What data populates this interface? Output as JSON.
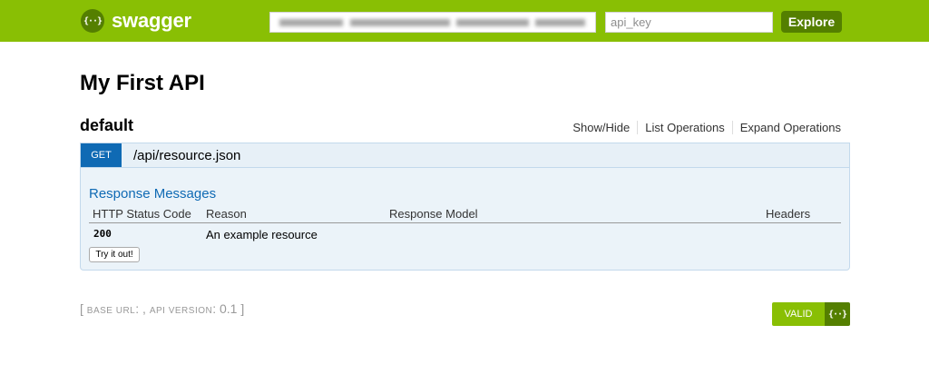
{
  "header": {
    "logo_icon": "{··}",
    "logo_text": "swagger",
    "url_value": "",
    "api_key_placeholder": "api_key",
    "explore_label": "Explore",
    "background_color": "#89bf04",
    "accent_dark": "#547f00"
  },
  "api": {
    "title": "My First API"
  },
  "resource": {
    "name": "default",
    "links": [
      "Show/Hide",
      "List Operations",
      "Expand Operations"
    ]
  },
  "operation": {
    "method": "GET",
    "method_color": "#0f6ab4",
    "path": "/api/resource.json",
    "response_messages_title": "Response Messages",
    "columns": [
      "HTTP Status Code",
      "Reason",
      "Response Model",
      "Headers"
    ],
    "rows": [
      {
        "code": "200",
        "reason": "An example resource",
        "model": "",
        "headers": ""
      }
    ],
    "try_button_label": "Try it out!"
  },
  "footer": {
    "open_bracket": "[",
    "base_url_label": "base url",
    "base_url_value": ": ,",
    "api_version_label": "api version",
    "api_version_value": ": 0.1",
    "close_bracket": "]",
    "valid_label": "VALID",
    "valid_icon": "{··}"
  }
}
